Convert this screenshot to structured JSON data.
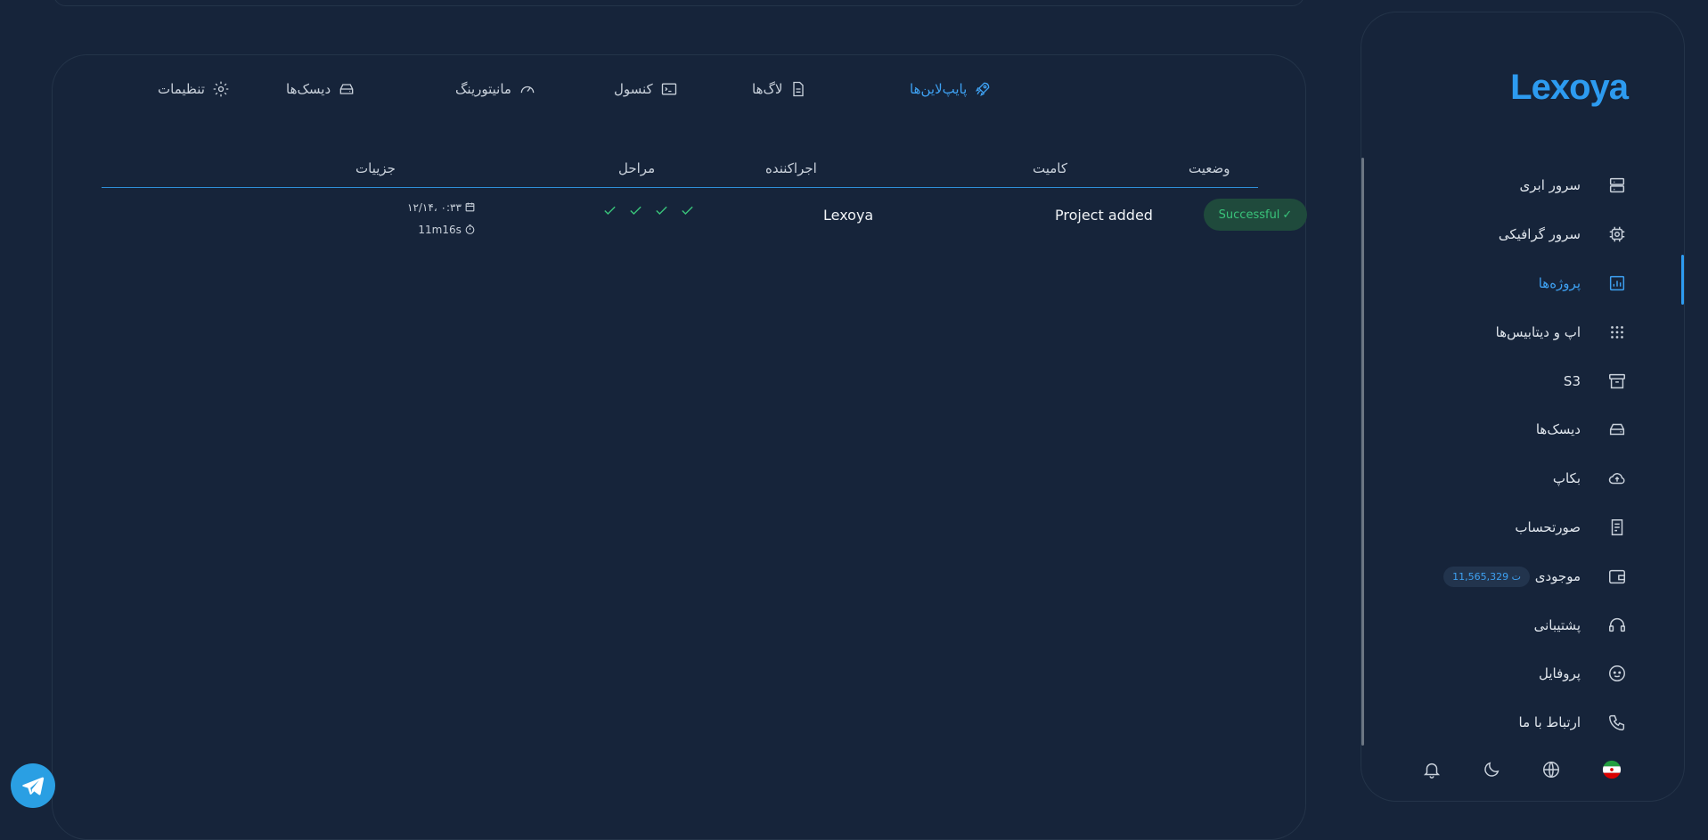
{
  "brand": {
    "logo": "Lexoya",
    "accent": "#2d9bf0"
  },
  "tabs": [
    {
      "label": "پایپ‌لاین‌ها",
      "icon": "rocket-icon",
      "active": true
    },
    {
      "label": "لاگ‌ها",
      "icon": "file-text-icon"
    },
    {
      "label": "کنسول",
      "icon": "terminal-icon"
    },
    {
      "label": "مانیتورینگ",
      "icon": "gauge-icon"
    },
    {
      "label": "دیسک‌ها",
      "icon": "disk-icon"
    },
    {
      "label": "تنظیمات",
      "icon": "gear-icon"
    }
  ],
  "table": {
    "headers": {
      "status": "وضعیت",
      "commit": "کامیت",
      "runner": "اجراکننده",
      "steps": "مراحل",
      "details": "جزییات"
    },
    "rows": [
      {
        "status": "Successful",
        "commit": "Project added",
        "runner": "Lexoya",
        "steps_completed": 4,
        "date": "۱۲/۱۴، ۰:۳۳",
        "duration": "11m16s"
      }
    ]
  },
  "sidebar": {
    "items": [
      {
        "label": "سرور ابری",
        "icon": "server-icon"
      },
      {
        "label": "سرور گرافیکی",
        "icon": "gpu-icon"
      },
      {
        "label": "پروژه‌ها",
        "icon": "chart-icon",
        "active": true
      },
      {
        "label": "اپ و دیتابیس‌ها",
        "icon": "grid-icon"
      },
      {
        "label": "S3",
        "icon": "archive-icon"
      },
      {
        "label": "دیسک‌ها",
        "icon": "disk-icon"
      },
      {
        "label": "بکاپ",
        "icon": "cloud-upload-icon"
      },
      {
        "label": "صورتحساب",
        "icon": "receipt-icon"
      },
      {
        "label": "موجودی",
        "icon": "wallet-icon",
        "balance": "11,565,329 ت"
      },
      {
        "label": "پشتیبانی",
        "icon": "headset-icon"
      },
      {
        "label": "پروفایل",
        "icon": "face-icon"
      },
      {
        "label": "ارتباط با ما",
        "icon": "phone-icon"
      }
    ],
    "footer_icons": [
      "flag-iran-icon",
      "globe-icon",
      "moon-icon",
      "bell-icon"
    ]
  },
  "colors": {
    "background": "#16243a",
    "success_bg": "#1f4a3c",
    "success_text": "#39c37a"
  }
}
